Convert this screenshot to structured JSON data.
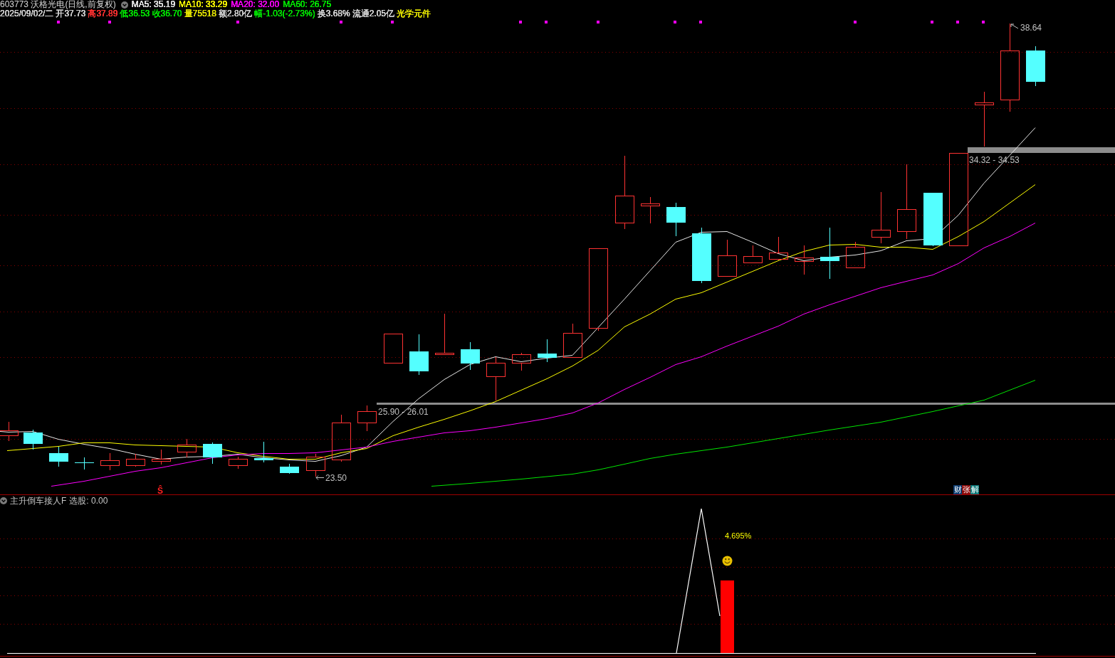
{
  "header": {
    "title": "603773 沃格光电(日线,前复权)",
    "moving_averages": [
      {
        "label": "MA5: 35.19",
        "color": "#e6e6e6"
      },
      {
        "label": "MA10: 33.29",
        "color": "#ffff00"
      },
      {
        "label": "MA20: 32.00",
        "color": "#ff00ff"
      },
      {
        "label": "MA60: 26.75",
        "color": "#00e600"
      }
    ]
  },
  "quote": [
    {
      "text": "2025/09/02/二",
      "color": "#d2d2d2"
    },
    {
      "text": "开37.73",
      "color": "#d2d2d2"
    },
    {
      "text": "高37.89",
      "color": "#ff3232"
    },
    {
      "text": "低36.53",
      "color": "#00e600"
    },
    {
      "text": "收36.70",
      "color": "#00e600"
    },
    {
      "text": "量75518",
      "color": "#e6e600"
    },
    {
      "text": "额2.80亿",
      "color": "#d2d2d2"
    },
    {
      "text": "幅-1.03(-2.73%)",
      "color": "#00e600"
    },
    {
      "text": "换3.68%",
      "color": "#d2d2d2"
    },
    {
      "text": "流通2.05亿",
      "color": "#d2d2d2"
    },
    {
      "text": "光学元件",
      "color": "#e6e600"
    }
  ],
  "main_chart": {
    "high_label": "38.64",
    "low_label": "23.50",
    "price_ranges": [
      {
        "text": "25.90 - 26.01"
      },
      {
        "text": "34.32 - 34.53"
      }
    ],
    "signal_mark": "Ŝ",
    "tags": [
      {
        "text": "财",
        "color": "#0c3c70"
      },
      {
        "text": "张",
        "color": "#8c0a0a"
      },
      {
        "text": "解",
        "color": "#0a7878"
      }
    ]
  },
  "indicator": {
    "name": "主升倒车接人F",
    "reading": "选股: 0.00",
    "value_label": "4.695%"
  }
}
